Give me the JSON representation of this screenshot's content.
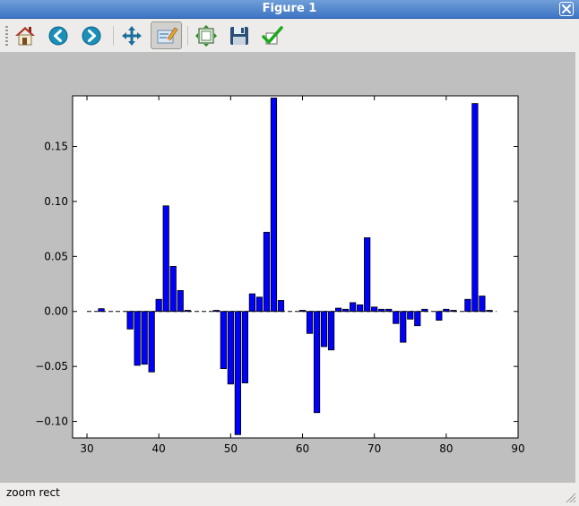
{
  "window": {
    "title": "Figure 1"
  },
  "toolbar": {
    "tools": [
      {
        "name": "home",
        "icon": "home-icon"
      },
      {
        "name": "back",
        "icon": "arrow-left-icon"
      },
      {
        "name": "forward",
        "icon": "arrow-right-icon"
      },
      {
        "name": "pan",
        "icon": "move-icon"
      },
      {
        "name": "zoom",
        "icon": "zoom-rect-icon",
        "active": true
      },
      {
        "name": "subplots",
        "icon": "subplots-icon"
      },
      {
        "name": "save",
        "icon": "floppy-disk-icon"
      },
      {
        "name": "edit",
        "icon": "checkmark-icon"
      }
    ]
  },
  "status": {
    "text": "zoom rect"
  },
  "colors": {
    "bar": "#0000ff",
    "canvas_bg": "#bfbfbf",
    "axes_bg": "#ffffff"
  },
  "chart_data": {
    "type": "bar",
    "x": [
      31,
      32,
      33,
      34,
      35,
      36,
      37,
      38,
      39,
      40,
      41,
      42,
      43,
      44,
      45,
      46,
      47,
      48,
      49,
      50,
      51,
      52,
      53,
      54,
      55,
      56,
      57,
      58,
      59,
      60,
      61,
      62,
      63,
      64,
      65,
      66,
      67,
      68,
      69,
      70,
      71,
      72,
      73,
      74,
      75,
      76,
      77,
      78,
      79,
      80,
      81,
      82,
      83,
      84,
      85,
      86
    ],
    "values": [
      0.0,
      0.0025,
      0.0,
      0.0,
      0.0,
      -0.016,
      -0.049,
      -0.048,
      -0.055,
      0.011,
      0.096,
      0.041,
      0.019,
      0.001,
      0.0,
      0.0,
      0.0,
      0.001,
      -0.052,
      -0.066,
      -0.112,
      -0.065,
      0.016,
      0.013,
      0.072,
      0.194,
      0.01,
      0.0,
      0.0,
      0.001,
      -0.02,
      -0.092,
      -0.032,
      -0.035,
      0.003,
      0.002,
      0.008,
      0.006,
      0.067,
      0.004,
      0.002,
      0.002,
      -0.011,
      -0.028,
      -0.007,
      -0.013,
      0.002,
      0.0,
      -0.008,
      0.002,
      0.001,
      0.0,
      0.011,
      0.189,
      0.014,
      0.001
    ],
    "bar_width": 0.8,
    "xlim": [
      28,
      90
    ],
    "ylim": [
      -0.115,
      0.196
    ],
    "xticks": [
      30,
      40,
      50,
      60,
      70,
      80,
      90
    ],
    "xtick_labels": [
      "30",
      "40",
      "50",
      "60",
      "70",
      "80",
      "90"
    ],
    "yticks": [
      -0.1,
      -0.05,
      0.0,
      0.05,
      0.1,
      0.15
    ],
    "ytick_labels": [
      "−0.10",
      "−0.05",
      "0.00",
      "0.05",
      "0.10",
      "0.15"
    ],
    "baseline": {
      "y": 0,
      "x_range": [
        30,
        87
      ],
      "style": "dashed"
    },
    "title": "",
    "xlabel": "",
    "ylabel": "",
    "grid": false
  }
}
